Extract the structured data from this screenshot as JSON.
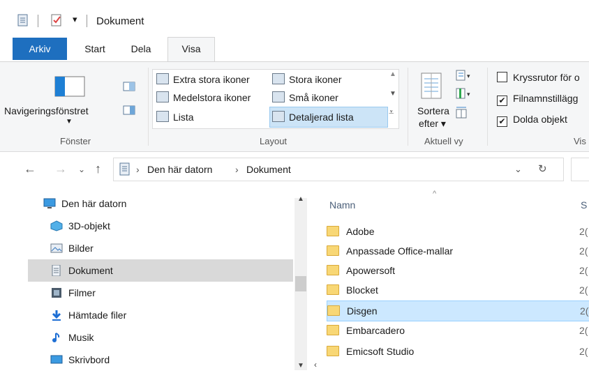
{
  "window": {
    "title": "Dokument"
  },
  "tabs": {
    "arkiv": "Arkiv",
    "start": "Start",
    "dela": "Dela",
    "visa": "Visa"
  },
  "ribbon": {
    "panes": {
      "navigation_pane_label": "Navigeringsfönstret",
      "group_label": "Fönster"
    },
    "layout": {
      "items": [
        "Extra stora ikoner",
        "Stora ikoner",
        "Medelstora ikoner",
        "Små ikoner",
        "Lista",
        "Detaljerad lista"
      ],
      "selected": "Detaljerad lista",
      "group_label": "Layout"
    },
    "current_view": {
      "sort_label_line1": "Sortera",
      "sort_label_line2": "efter ▾",
      "group_label": "Aktuell vy"
    },
    "show_hide": {
      "items": [
        {
          "label": "Kryssrutor för o",
          "checked": false
        },
        {
          "label": "Filnamnstillägg",
          "checked": true
        },
        {
          "label": "Dolda objekt",
          "checked": true
        }
      ],
      "group_label_partial": "Vis"
    }
  },
  "address": {
    "crumbs": [
      "Den här datorn",
      "Dokument"
    ],
    "separator": "›"
  },
  "nav": {
    "items": [
      {
        "label": "Den här datorn",
        "icon": "computer-icon"
      },
      {
        "label": "3D-objekt",
        "icon": "cube-icon"
      },
      {
        "label": "Bilder",
        "icon": "pictures-icon"
      },
      {
        "label": "Dokument",
        "icon": "document-icon"
      },
      {
        "label": "Filmer",
        "icon": "film-icon"
      },
      {
        "label": "Hämtade filer",
        "icon": "download-icon"
      },
      {
        "label": "Musik",
        "icon": "music-icon"
      },
      {
        "label": "Skrivbord",
        "icon": "desktop-icon"
      }
    ],
    "selected": "Dokument"
  },
  "files": {
    "columns": {
      "name": "Namn",
      "date_partial": "S"
    },
    "rows": [
      {
        "name": "Adobe",
        "date": "2("
      },
      {
        "name": "Anpassade Office-mallar",
        "date": "2("
      },
      {
        "name": "Apowersoft",
        "date": "2("
      },
      {
        "name": "Blocket",
        "date": "2("
      },
      {
        "name": "Disgen",
        "date": "2("
      },
      {
        "name": "Embarcadero",
        "date": "2("
      },
      {
        "name": "Emicsoft Studio",
        "date": "2("
      }
    ],
    "selected": "Disgen"
  }
}
